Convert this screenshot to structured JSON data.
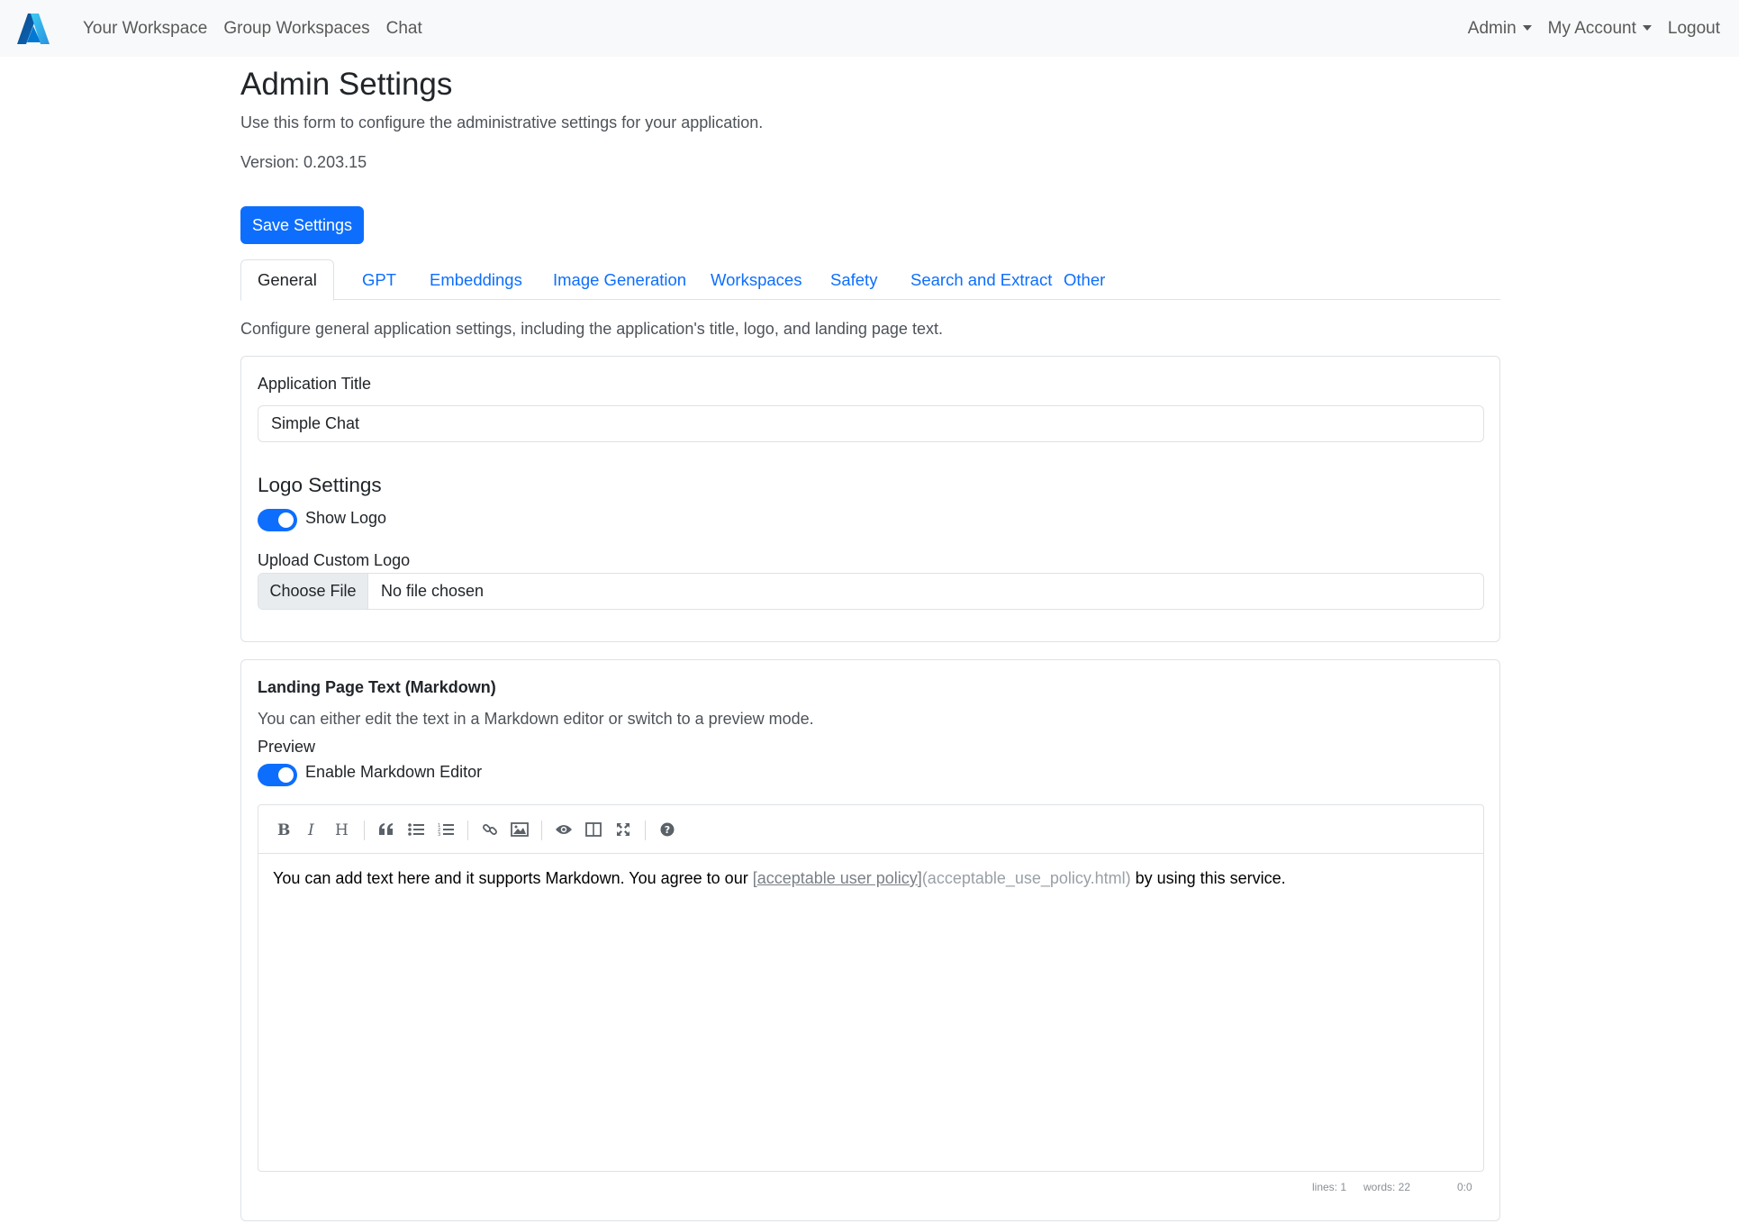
{
  "nav": {
    "links": [
      "Your Workspace",
      "Group Workspaces",
      "Chat"
    ],
    "admin": "Admin",
    "my_account": "My Account",
    "logout": "Logout",
    "brand_icon": "azure-logo-icon"
  },
  "page": {
    "title": "Admin Settings",
    "description": "Use this form to configure the administrative settings for your application.",
    "version": "Version: 0.203.15",
    "save_label": "Save Settings"
  },
  "tabs": [
    "General",
    "GPT",
    "Embeddings",
    "Image Generation",
    "Workspaces",
    "Safety",
    "Search and Extract",
    "Other"
  ],
  "general": {
    "description": "Configure general application settings, including the application's title, logo, and landing page text.",
    "app_title_label": "Application Title",
    "app_title_value": "Simple Chat",
    "logo_heading": "Logo Settings",
    "show_logo_label": "Show Logo",
    "upload_logo_label": "Upload Custom Logo",
    "choose_file": "Choose File",
    "no_file": "No file chosen"
  },
  "landing": {
    "heading": "Landing Page Text (Markdown)",
    "description": "You can either edit the text in a Markdown editor or switch to a preview mode.",
    "preview_label": "Preview",
    "enable_editor_label": "Enable Markdown Editor",
    "text_before": "You can add text here and it supports Markdown. You agree to our ",
    "link_text": "[acceptable user policy]",
    "link_url": "(acceptable_use_policy.html)",
    "text_after": " by using this service.",
    "status_lines": "lines: 1",
    "status_words": "words: 22",
    "status_cursor": "0:0"
  },
  "colors": {
    "primary": "#0d6efd",
    "navbar_bg": "#f8f9fa"
  }
}
